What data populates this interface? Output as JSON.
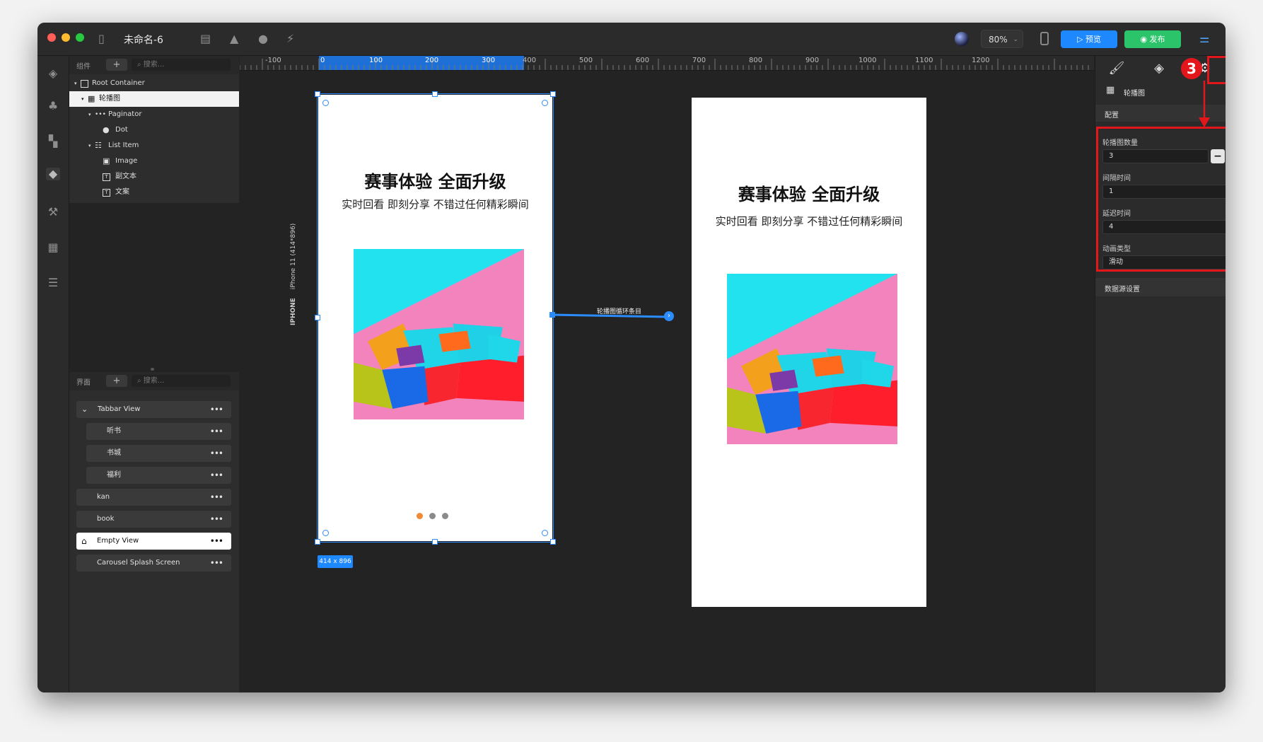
{
  "titlebar": {
    "title": "未命名-6",
    "zoom": "80%",
    "preview_label": "预览",
    "publish_label": "发布"
  },
  "layers": {
    "header_label": "组件",
    "search_placeholder": "搜索...",
    "items": [
      {
        "label": "Root Container",
        "icon": "square-icon"
      },
      {
        "label": "轮播图",
        "icon": "carousel-icon"
      },
      {
        "label": "Paginator",
        "icon": "dots-icon"
      },
      {
        "label": "Dot",
        "icon": "shapes-icon"
      },
      {
        "label": "List Item",
        "icon": "list-item-icon"
      },
      {
        "label": "Image",
        "icon": "image-icon"
      },
      {
        "label": "副文本",
        "icon": "text-icon"
      },
      {
        "label": "文案",
        "icon": "text-icon"
      }
    ]
  },
  "screens": {
    "header_label": "界面",
    "search_placeholder": "搜索...",
    "items": [
      {
        "label": "Tabbar View"
      },
      {
        "label": "听书"
      },
      {
        "label": "书城"
      },
      {
        "label": "福利"
      },
      {
        "label": "kan"
      },
      {
        "label": "book"
      },
      {
        "label": "Empty View"
      },
      {
        "label": "Carousel Splash Screen"
      }
    ]
  },
  "ruler": {
    "labels": [
      "-100",
      "0",
      "100",
      "200",
      "300",
      "400",
      "500",
      "600",
      "700",
      "800",
      "900",
      "1000",
      "1100",
      "1200"
    ]
  },
  "canvas": {
    "device_label": "iPhone 11 (414*896)",
    "device_type": "IPHONE",
    "size_badge": "414 x 896",
    "connection_label": "轮播图循环条目",
    "phone1": {
      "title": "赛事体验 全面升级",
      "subtitle": "实时回看 即刻分享 不错过任何精彩瞬间"
    },
    "phone2": {
      "title": "赛事体验 全面升级",
      "subtitle": "实时回看 即刻分享 不错过任何精彩瞬间"
    }
  },
  "inspector": {
    "component_name": "轮播图",
    "section_config": "配置",
    "count_label": "轮播图数量",
    "count_value": "3",
    "interval_label": "间隔时间",
    "interval_value": "1",
    "delay_label": "延迟时间",
    "delay_value": "4",
    "animation_label": "动画类型",
    "animation_value": "滑动",
    "section_datasource": "数据源设置",
    "step_badge": "3"
  },
  "colors": {
    "accent_blue": "#1e88ff",
    "publish_green": "#2cc46a",
    "highlight_red": "#e3161c",
    "dot_active": "#f08a34"
  }
}
